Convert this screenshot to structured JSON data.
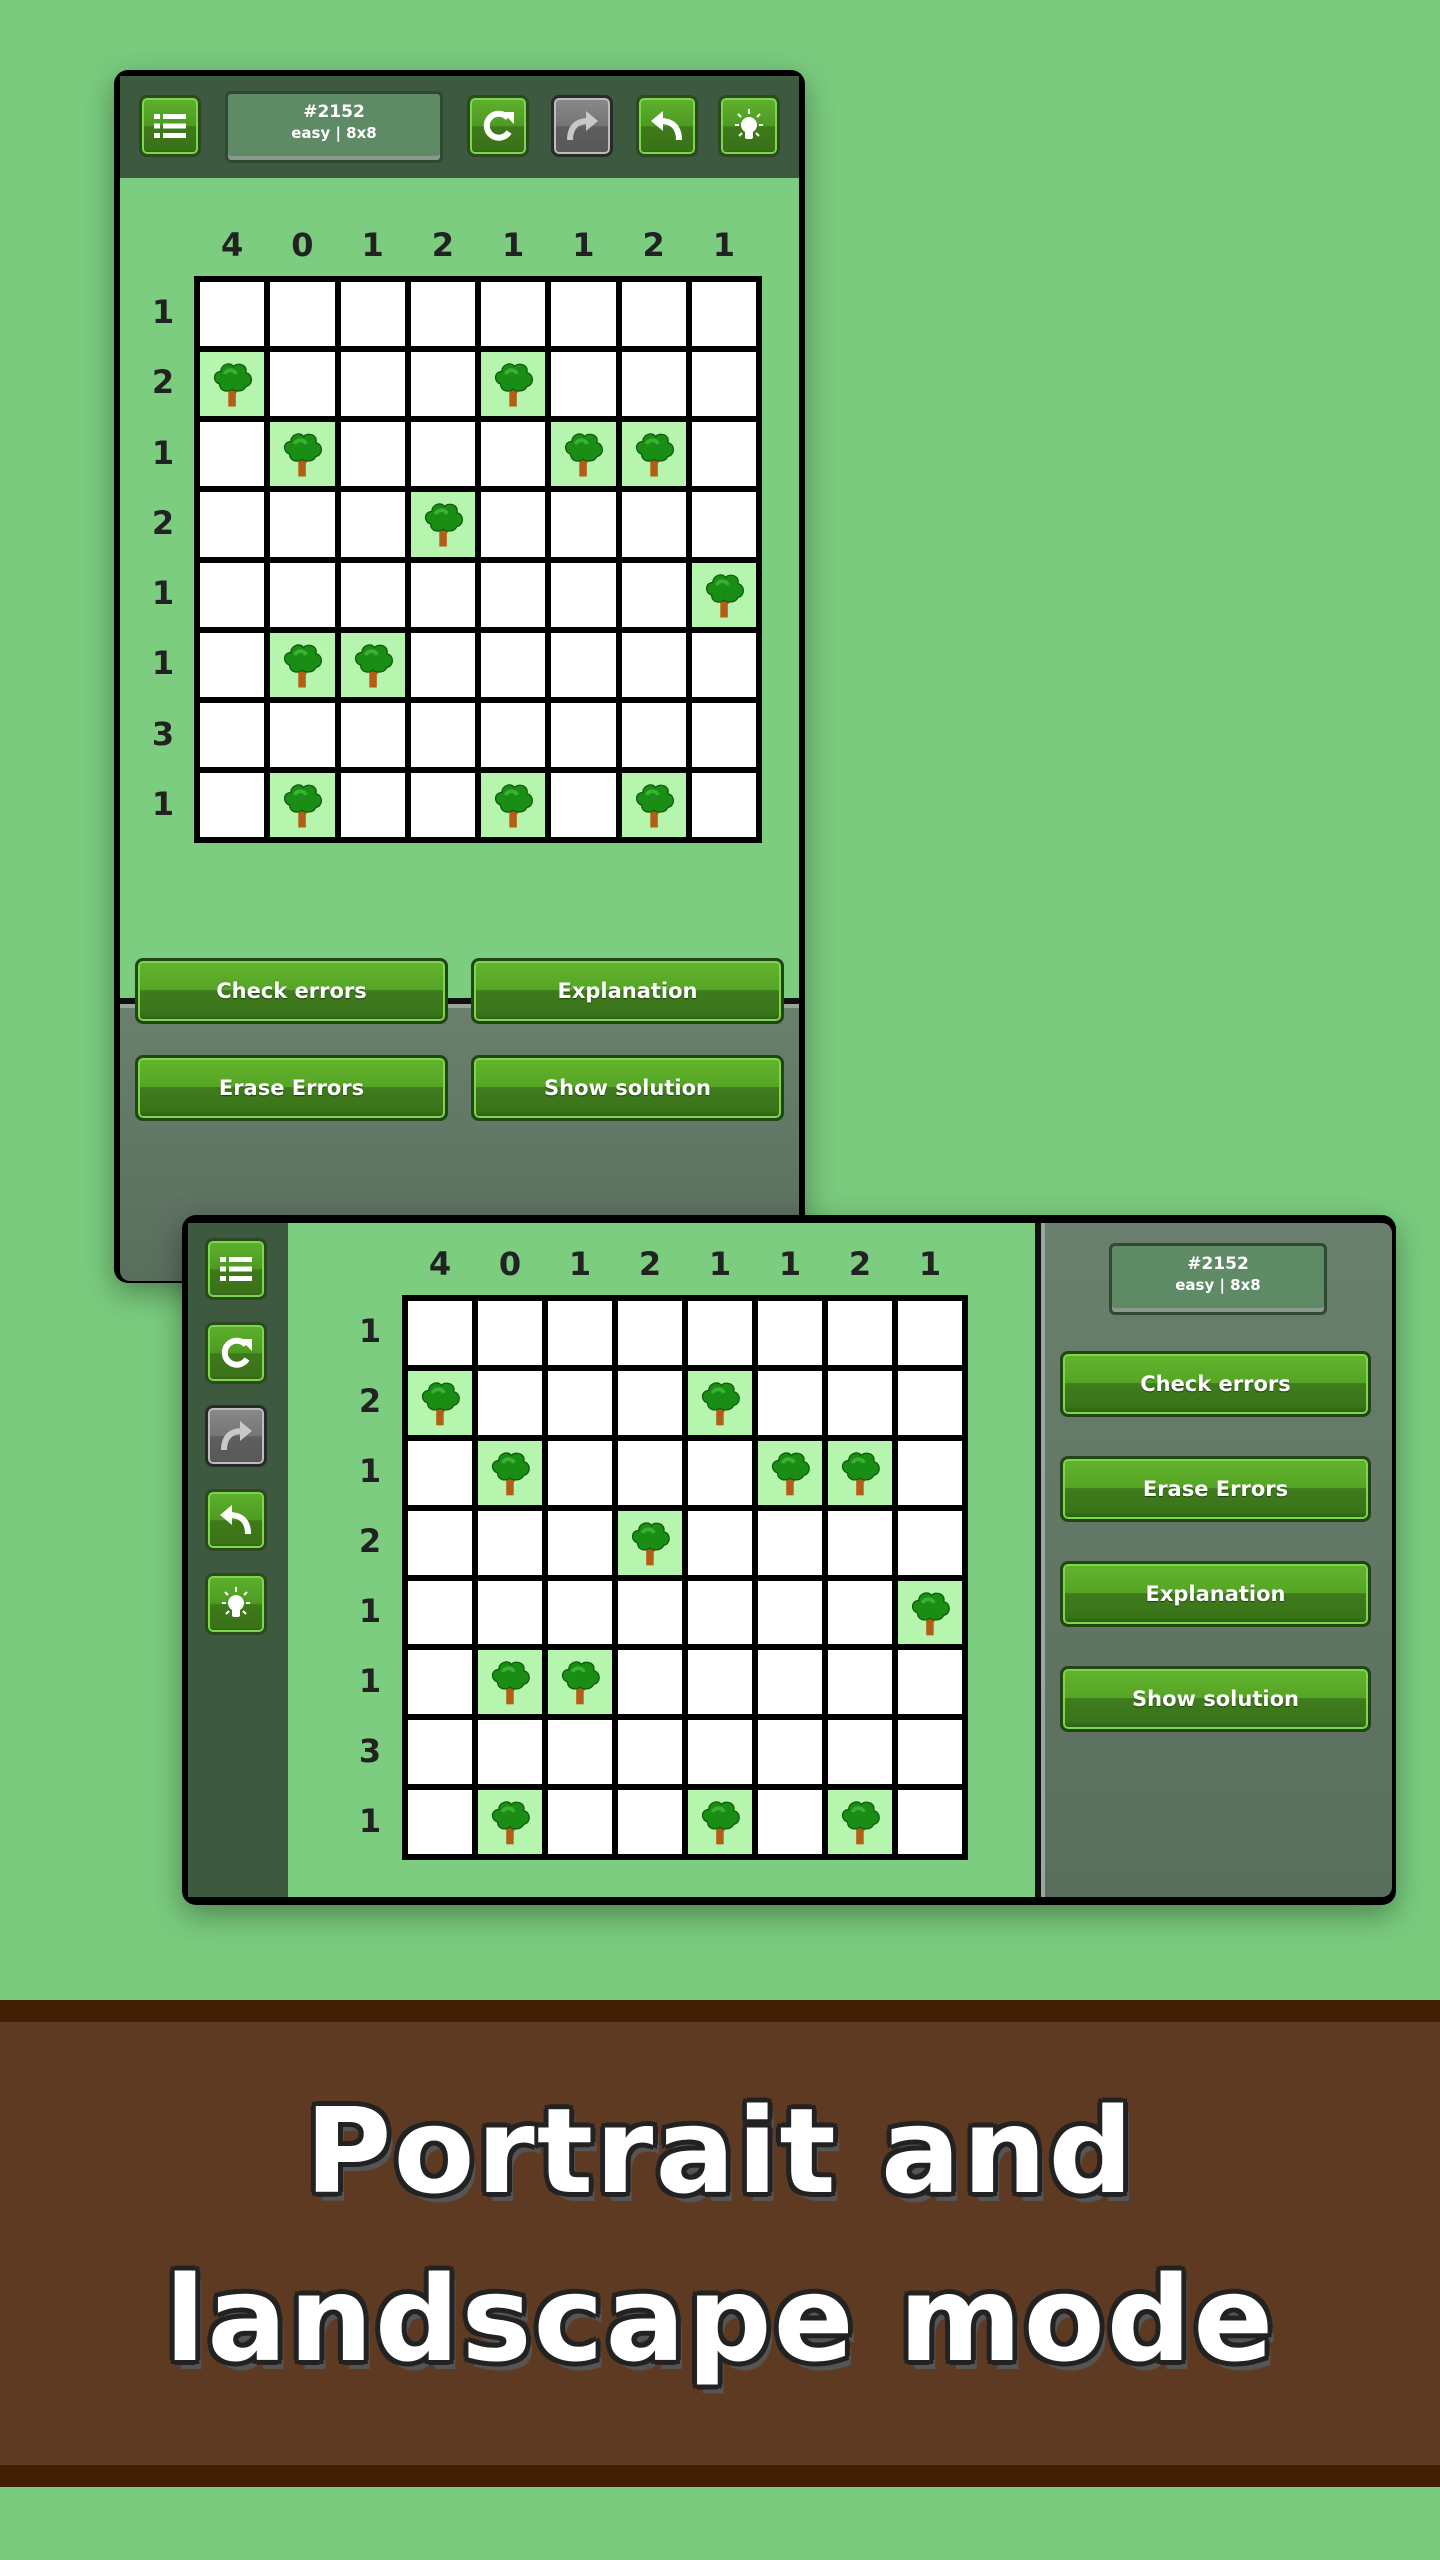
{
  "puzzle": {
    "id_label": "#2152",
    "meta_label": "easy | 8x8",
    "column_clues": [
      "4",
      "0",
      "1",
      "2",
      "1",
      "1",
      "2",
      "1"
    ],
    "row_clues": [
      "1",
      "2",
      "1",
      "2",
      "1",
      "1",
      "3",
      "1"
    ],
    "trees": [
      [
        0,
        0,
        0,
        0,
        0,
        0,
        0,
        0
      ],
      [
        1,
        0,
        0,
        0,
        1,
        0,
        0,
        0
      ],
      [
        0,
        1,
        0,
        0,
        0,
        1,
        1,
        0
      ],
      [
        0,
        0,
        0,
        1,
        0,
        0,
        0,
        0
      ],
      [
        0,
        0,
        0,
        0,
        0,
        0,
        0,
        1
      ],
      [
        0,
        1,
        1,
        0,
        0,
        0,
        0,
        0
      ],
      [
        0,
        0,
        0,
        0,
        0,
        0,
        0,
        0
      ],
      [
        0,
        1,
        0,
        0,
        1,
        0,
        1,
        0
      ]
    ]
  },
  "toolbar": {
    "menu": "menu-icon",
    "restart": "restart-icon",
    "redo": "redo-icon",
    "undo": "undo-icon",
    "hint": "hint-lightbulb-icon",
    "redo_disabled": true
  },
  "actions": {
    "check_errors": "Check errors",
    "explanation": "Explanation",
    "erase_errors": "Erase Errors",
    "show_solution": "Show solution"
  },
  "banner": {
    "line1": "Portrait and",
    "line2": "landscape mode"
  },
  "colors": {
    "background": "#7acb7e",
    "tree_cell": "#b6f5ae",
    "button_green": "#56a526",
    "banner_brown": "#5f3a22"
  }
}
